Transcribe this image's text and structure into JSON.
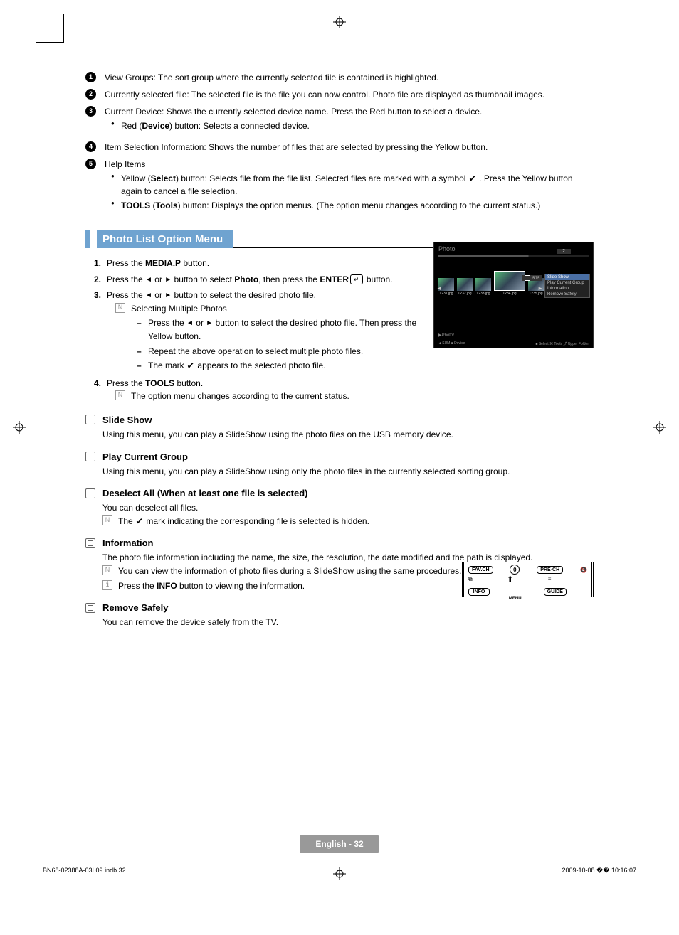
{
  "reg_mark": "◈",
  "definitions": {
    "1": "View Groups: The sort group where the currently selected file is contained is highlighted.",
    "2": "Currently selected file: The selected file is the file you can now control. Photo file are displayed as thumbnail images.",
    "3": "Current Device: Shows the currently selected device name. Press the Red button to select a device.",
    "3_sub": {
      "prefix": "Red (",
      "bold": "Device",
      "suffix": ") button: Selects a connected device."
    },
    "4": "Item Selection Information: Shows the number of files that are selected by pressing the Yellow button.",
    "5": "Help Items",
    "5_sub1": {
      "prefix": "Yellow (",
      "bold": "Select",
      "suffix_a": ") button: Selects file from the file list. Selected files are marked with a symbol ",
      "suffix_b": " . Press the Yellow button again to cancel a file selection."
    },
    "5_sub2": {
      "bold1": "TOOLS",
      "mid": " (",
      "bold2": "Tools",
      "suffix": ") button: Displays the option menus. (The option menu changes according to the current status.)"
    }
  },
  "section_title": "Photo List Option Menu",
  "steps": {
    "1": {
      "prefix": "Press the ",
      "bold": "MEDIA.P",
      "suffix": " button."
    },
    "2": {
      "a": "Press the ",
      "b": " or ",
      "c": " button to select ",
      "bold": "Photo",
      "d": ", then press the ",
      "bold2": "ENTER",
      "e": " button."
    },
    "3": {
      "a": "Press the ",
      "b": " or ",
      "c": " button to select the desired photo file."
    },
    "3_note": "Selecting Multiple Photos",
    "3_d1": {
      "a": "Press the ",
      "b": " or ",
      "c": " button to select the desired photo file. Then press the Yellow button."
    },
    "3_d2": "Repeat the above operation to select multiple photo files.",
    "3_d3": {
      "a": "The mark ",
      "b": " appears to the selected photo file."
    },
    "4": {
      "prefix": "Press the ",
      "bold": "TOOLS",
      "suffix": " button."
    },
    "4_note": "The option menu changes according to the current status."
  },
  "qsections": {
    "slide": {
      "title": "Slide Show",
      "body": "Using this menu, you can play a SlideShow using the photo files on the USB memory device."
    },
    "group": {
      "title": "Play Current Group",
      "body": "Using this menu, you can play a SlideShow using only the photo files in the currently selected sorting group."
    },
    "deselect": {
      "title": "Deselect All (When at least one file is selected)",
      "body": "You can deselect all files.",
      "note_a": "The ",
      "note_b": " mark indicating the corresponding file is selected is hidden."
    },
    "info": {
      "title": "Information",
      "body": "The photo file information including the name, the size, the resolution, the date modified and the path is displayed.",
      "note1": "You can view the information of photo files during a SlideShow using the same procedures.",
      "note2_a": "Press the ",
      "note2_bold": "INFO",
      "note2_b": " button to viewing the information."
    },
    "remove": {
      "title": "Remove Safely",
      "body": "You can remove the device safely from the TV."
    }
  },
  "tv": {
    "header": "Photo",
    "counter": "5/15",
    "menu": [
      "Slide Show",
      "Play Current Group",
      "Information",
      "Remove Safely"
    ],
    "thumbs": [
      "1231.jpg",
      "1232.jpg",
      "1233.jpg",
      "1234.jpg",
      "1235.jpg"
    ],
    "path": "▶Photo/",
    "bottom_left": "◀ SUM   ■ Device",
    "bottom_right": "■ Select  ⌘ Tools  ⤴ Upper Folder"
  },
  "remote": {
    "fav": "FAV.CH",
    "zero": "0",
    "pre": "PRE-CH",
    "info": "INFO",
    "menu": "MENU",
    "guide": "GUIDE"
  },
  "footer": "English - 32",
  "bottom_left": "BN68-02388A-03L09.indb   32",
  "bottom_right": "2009-10-08   �� 10:16:07"
}
